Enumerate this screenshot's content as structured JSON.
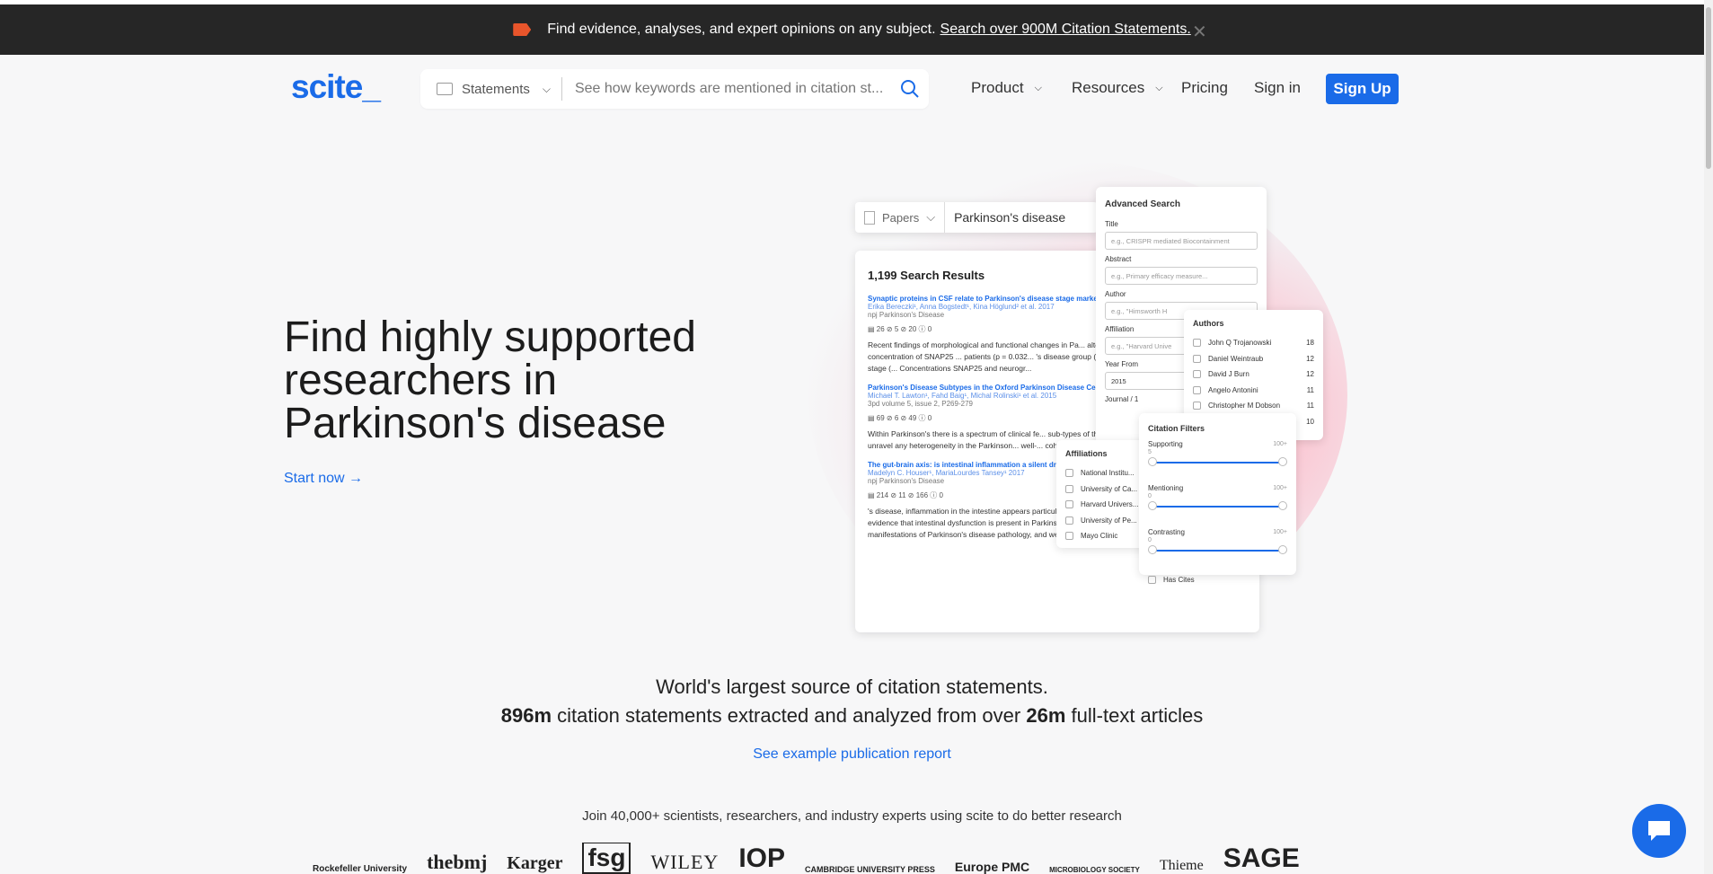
{
  "banner": {
    "text": "Find evidence, analyses, and expert opinions on any subject.",
    "link": "Search over 900M Citation Statements.",
    "close_icon": "close-icon"
  },
  "header": {
    "logo": "scite_",
    "search": {
      "mode": "Statements",
      "placeholder": "See how keywords are mentioned in citation st..."
    },
    "nav": {
      "product": "Product",
      "resources": "Resources",
      "pricing": "Pricing",
      "signin": "Sign in",
      "signup": "Sign Up"
    }
  },
  "hero": {
    "title": "Find highly supported researchers in Parkinson's disease",
    "cta": "Start now"
  },
  "illustration": {
    "search_mode": "Papers",
    "search_query": "Parkinson's disease",
    "results_title": "1,199 Search Results",
    "results": [
      {
        "title": "Synaptic proteins in CSF relate to Parkinson's disease stage markers",
        "authors": "Erika Bereczki¹, Anna Bogstedt¹, Kina Höglund² et al. 2017",
        "journal": "npj Parkinson's Disease",
        "badges": "▤ 26   ⊘ 5   ⊘ 20   ⓘ 0",
        "excerpt": "Recent findings of morphological and functional changes in Pa... altered... An overall increase in the concentration of SNAP25 ... patients (p = 0.032... 's disease group (p = 0.017), as well as i... motor disease stage (... Concentrations SNAP25 and neurogr..."
      },
      {
        "title": "Parkinson's Disease Subtypes in the Oxford Parkinson Disease Centre...",
        "authors": "Michael T. Lawton¹, Fahd Baig¹, Michal Rolinski¹ et al. 2015",
        "journal": "3pd volume 5, issue 2, P269-279",
        "badges": "▤ 69   ⊘ 6   ⊘ 49   ⓘ 0",
        "excerpt": "Within Parkinson's there is a spectrum of clinical fe... sub-types of the disease.... how best to group patie... unravel any heterogeneity in the Parkinson... well-... cohort.Methods: 769 consecutive patients, with me..."
      },
      {
        "title": "The gut-brain axis: is intestinal inflammation a silent drive...",
        "authors": "Madelyn C. Houser¹, MariaLourdes Tansey¹ 2017",
        "journal": "npj Parkinson's Disease",
        "badges": "▤ 214   ⊘ 11   ⊘ 166   ⓘ 0",
        "excerpt": "'s disease, inflammation in the intestine appears particularly relevant in pathogenesis.... We review the evidence that intestinal dysfunction is present in Parkinson's disease and that it may... reflect the earliest manifestations of Parkinson's disease pathology, and we link these findings to dysregulated..."
      }
    ],
    "advanced": {
      "title": "Advanced Search",
      "fields": [
        {
          "label": "Title",
          "placeholder": "e.g., CRISPR mediated Biocontainment"
        },
        {
          "label": "Abstract",
          "placeholder": "e.g., Primary efficacy measure..."
        },
        {
          "label": "Author",
          "placeholder": "e.g., \"Himsworth H"
        },
        {
          "label": "Affiliation",
          "placeholder": "e.g., \"Harvard Unive"
        },
        {
          "label": "Year From",
          "placeholder": "2015"
        },
        {
          "label": "Journal / 1",
          "placeholder": ""
        }
      ]
    },
    "authors": {
      "title": "Authors",
      "items": [
        {
          "name": "John Q Trojanowski",
          "count": "18"
        },
        {
          "name": "Daniel Weintraub",
          "count": "12"
        },
        {
          "name": "David J Burn",
          "count": "12"
        },
        {
          "name": "Angelo Antonini",
          "count": "11"
        },
        {
          "name": "Christopher M Dobson",
          "count": "11"
        },
        {
          "name": "",
          "count": "10"
        }
      ]
    },
    "affiliations": {
      "title": "Affiliations",
      "items": [
        "National Institu...",
        "University of Ca...",
        "Harvard Univers...",
        "University of Pe...",
        "Mayo Clinic"
      ]
    },
    "citation_filters": {
      "title": "Citation Filters",
      "sliders": [
        {
          "label": "Supporting",
          "min": "5",
          "max": "100+"
        },
        {
          "label": "Mentioning",
          "min": "0",
          "max": "100+"
        },
        {
          "label": "Contrasting",
          "min": "0",
          "max": "100+"
        }
      ],
      "has_cites": "Has Cites"
    }
  },
  "stats": {
    "line1": "World's largest source of citation statements.",
    "statements_count": "896m",
    "middle": "citation statements extracted and analyzed from over",
    "articles_count": "26m",
    "tail": "full-text articles",
    "example_link": "See example publication report"
  },
  "join": "Join 40,000+ scientists, researchers, and industry experts using scite to do better research",
  "partner_logos": [
    "Rockefeller University",
    "thebmj",
    "Karger",
    "fsg",
    "WILEY",
    "IOP",
    "CAMBRIDGE UNIVERSITY PRESS",
    "Europe PMC",
    "MICROBIOLOGY SOCIETY",
    "Thieme",
    "SAGE"
  ],
  "colors": {
    "accent": "#1a6be8",
    "banner_bg": "#262626",
    "banner_tag": "#e8552b",
    "page_bg": "#f7f7f8"
  },
  "chat_icon": "chat-bubble-icon"
}
